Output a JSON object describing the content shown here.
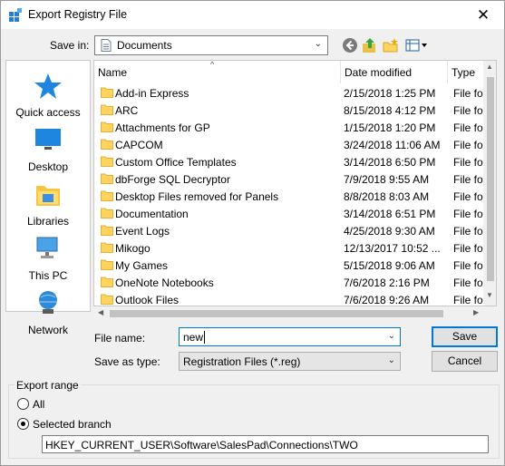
{
  "window": {
    "title": "Export Registry File",
    "close_glyph": "✕"
  },
  "toolbar": {
    "save_in_label": "Save in:",
    "save_in_value": "Documents",
    "icons": [
      "back-icon",
      "up-folder-icon",
      "new-folder-icon",
      "view-menu-icon"
    ]
  },
  "places": [
    {
      "label": "Quick access",
      "icon": "star-icon"
    },
    {
      "label": "Desktop",
      "icon": "desktop-icon"
    },
    {
      "label": "Libraries",
      "icon": "libraries-icon"
    },
    {
      "label": "This PC",
      "icon": "this-pc-icon"
    },
    {
      "label": "Network",
      "icon": "network-icon"
    }
  ],
  "columns": {
    "name": "Name",
    "date": "Date modified",
    "type": "Type"
  },
  "files": [
    {
      "name": "Add-in Express",
      "date": "2/15/2018 1:25 PM",
      "type": "File fol"
    },
    {
      "name": "ARC",
      "date": "8/15/2018 4:12 PM",
      "type": "File fol"
    },
    {
      "name": "Attachments for GP",
      "date": "1/15/2018 1:20 PM",
      "type": "File fol"
    },
    {
      "name": "CAPCOM",
      "date": "3/24/2018 11:06 AM",
      "type": "File fol"
    },
    {
      "name": "Custom Office Templates",
      "date": "3/14/2018 6:50 PM",
      "type": "File fol"
    },
    {
      "name": "dbForge SQL Decryptor",
      "date": "7/9/2018 9:55 AM",
      "type": "File fol"
    },
    {
      "name": "Desktop Files removed for Panels",
      "date": "8/8/2018 8:03 AM",
      "type": "File fol"
    },
    {
      "name": "Documentation",
      "date": "3/14/2018 6:51 PM",
      "type": "File fol"
    },
    {
      "name": "Event Logs",
      "date": "4/25/2018 9:30 AM",
      "type": "File fol"
    },
    {
      "name": "Mikogo",
      "date": "12/13/2017 10:52 ...",
      "type": "File fol"
    },
    {
      "name": "My Games",
      "date": "5/15/2018 9:06 AM",
      "type": "File fol"
    },
    {
      "name": "OneNote Notebooks",
      "date": "7/6/2018 2:16 PM",
      "type": "File fol"
    },
    {
      "name": "Outlook Files",
      "date": "7/6/2018 9:26 AM",
      "type": "File fol"
    }
  ],
  "form": {
    "file_name_label": "File name:",
    "file_name_value": "new",
    "save_as_type_label": "Save as type:",
    "save_as_type_value": "Registration Files (*.reg)",
    "save_button": "Save",
    "cancel_button": "Cancel"
  },
  "export_range": {
    "title": "Export range",
    "all_label": "All",
    "selected_label": "Selected branch",
    "selected": "Selected branch",
    "branch_value": "HKEY_CURRENT_USER\\Software\\SalesPad\\Connections\\TWO"
  }
}
